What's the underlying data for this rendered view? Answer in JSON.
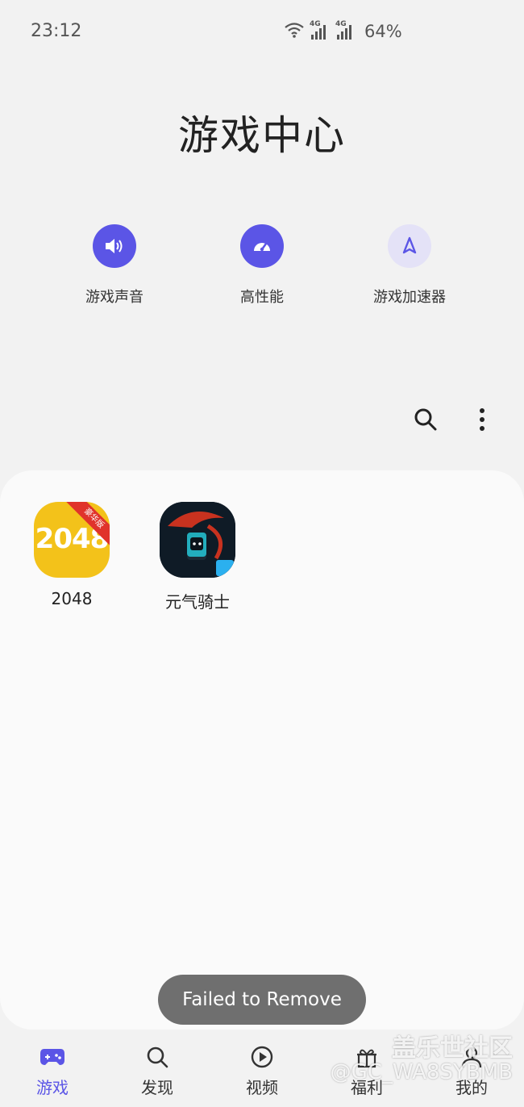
{
  "status": {
    "time": "23:12",
    "net1": "4G",
    "net2": "4G",
    "battery": "64%"
  },
  "header": {
    "title": "游戏中心"
  },
  "quick_actions": [
    {
      "label": "游戏声音",
      "icon": "speaker-icon"
    },
    {
      "label": "高性能",
      "icon": "gauge-icon"
    },
    {
      "label": "游戏加速器",
      "icon": "rocket-icon"
    }
  ],
  "toolbar": {
    "search_icon": "search-icon",
    "more_icon": "more-vertical-icon"
  },
  "apps": [
    {
      "label": "2048",
      "icon_text": "2048",
      "badge": "豪华版"
    },
    {
      "label": "元气骑士"
    }
  ],
  "toast": {
    "message": "Failed to Remove"
  },
  "nav": {
    "items": [
      {
        "label": "游戏",
        "icon": "gamepad-icon",
        "active": true
      },
      {
        "label": "发现",
        "icon": "search-icon"
      },
      {
        "label": "视频",
        "icon": "play-icon"
      },
      {
        "label": "福利",
        "icon": "gift-icon"
      },
      {
        "label": "我的",
        "icon": "person-icon"
      }
    ]
  },
  "watermark": {
    "line1": "盖乐世社区",
    "line2": "@GC_WA8SYBMB"
  },
  "colors": {
    "accent": "#5b55e6",
    "accent_light": "#e4e2f7",
    "app_2048_bg": "#f3c21a",
    "toast_bg": "#6f6f6f"
  }
}
